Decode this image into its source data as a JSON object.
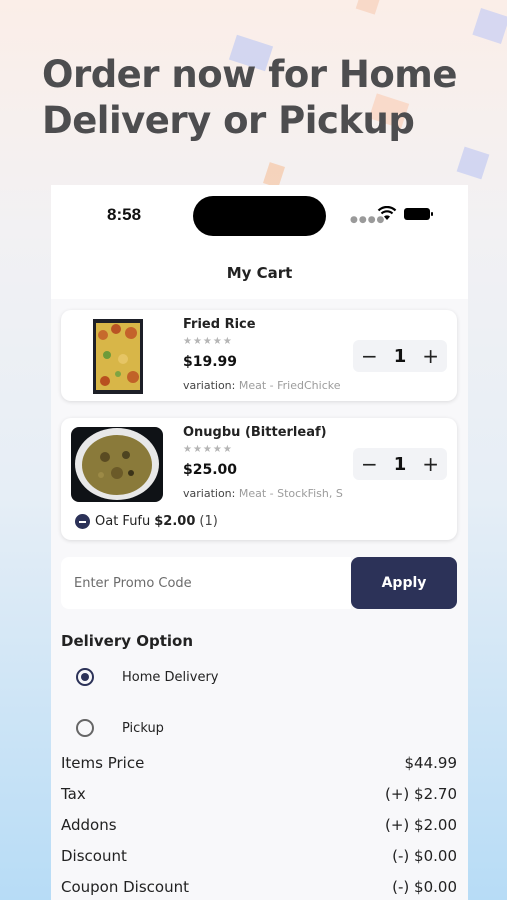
{
  "headline": "Order now for Home Delivery or Pickup",
  "status_bar": {
    "time": "8:58"
  },
  "nav": {
    "title": "My Cart"
  },
  "cart_items": [
    {
      "name": "Fried Rice",
      "stars": "★★★★★",
      "price": "$19.99",
      "variation_label": "variation:",
      "variation_value": "Meat - FriedChicke",
      "quantity": "1"
    },
    {
      "name": "Onugbu (Bitterleaf)",
      "stars": "★★★★★",
      "price": "$25.00",
      "variation_label": "variation:",
      "variation_value": "Meat - StockFish, S",
      "quantity": "1",
      "addon": {
        "name": "Oat Fufu",
        "price": "$2.00",
        "count": "(1)"
      }
    }
  ],
  "promo": {
    "placeholder": "Enter Promo Code",
    "apply_label": "Apply"
  },
  "delivery": {
    "title": "Delivery Option",
    "options": [
      {
        "label": "Home Delivery",
        "selected": true
      },
      {
        "label": "Pickup",
        "selected": false
      }
    ]
  },
  "summary": [
    {
      "label": "Items Price",
      "value": "$44.99"
    },
    {
      "label": "Tax",
      "value": "(+) $2.70"
    },
    {
      "label": "Addons",
      "value": "(+) $2.00"
    },
    {
      "label": "Discount",
      "value": "(-) $0.00"
    },
    {
      "label": "Coupon Discount",
      "value": "(-) $0.00"
    }
  ],
  "colors": {
    "primary": "#2c3258",
    "headline": "#4d4d4f"
  }
}
